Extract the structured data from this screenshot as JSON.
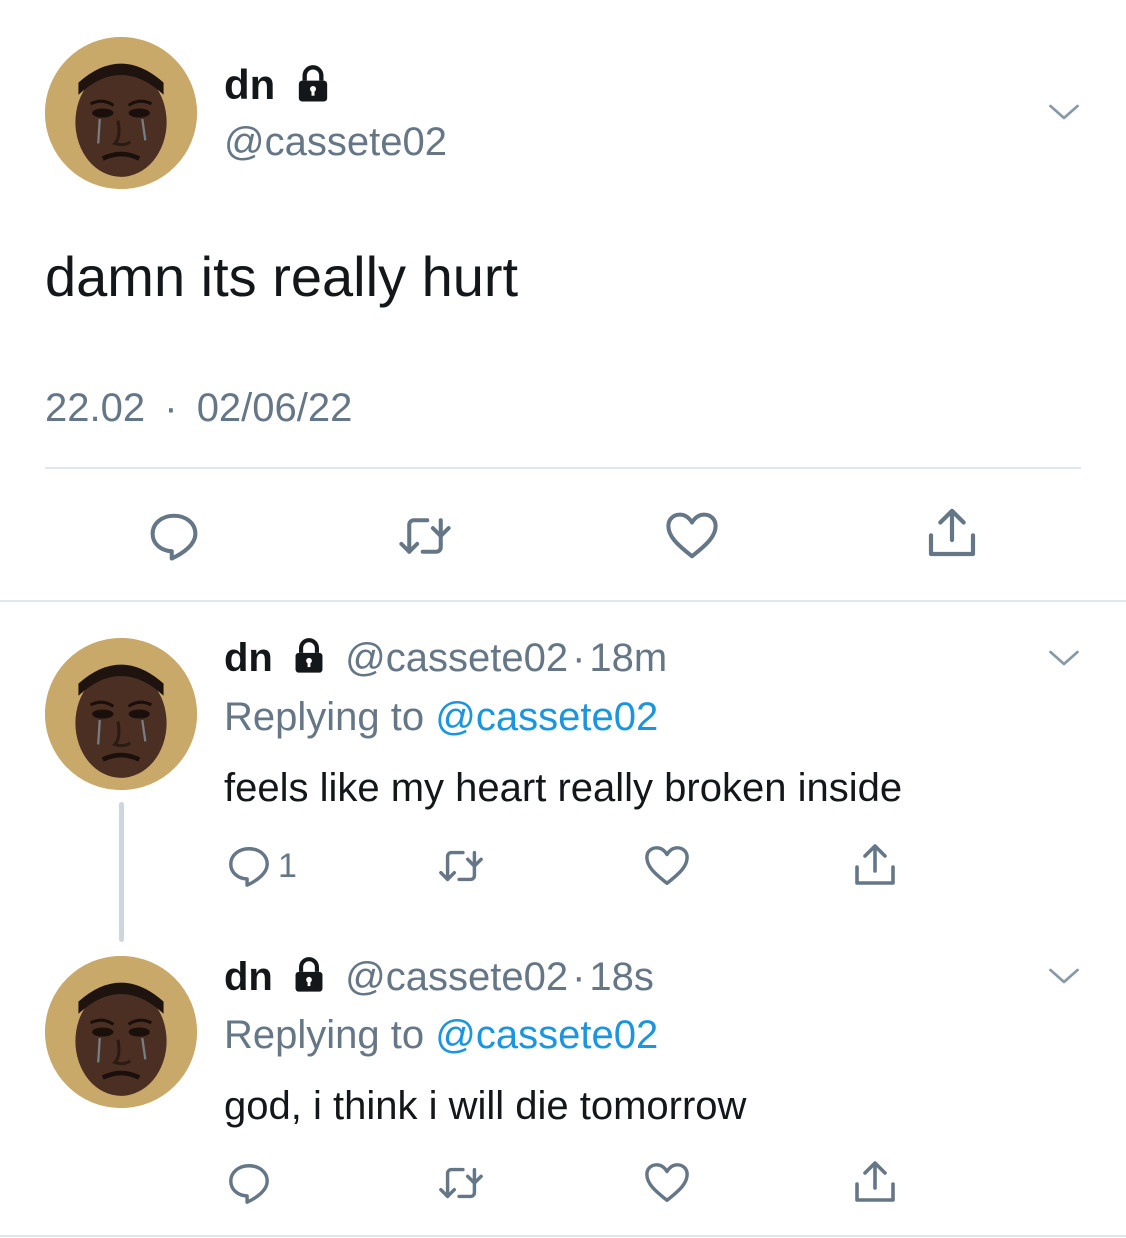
{
  "main_tweet": {
    "display_name": "dn",
    "handle": "@cassete02",
    "text": "damn its really hurt",
    "time": "22.02",
    "date": "02/06/22"
  },
  "replies": [
    {
      "display_name": "dn",
      "handle": "@cassete02",
      "age": "18m",
      "replying_prefix": "Replying to",
      "replying_handle": "@cassete02",
      "text": "feels like my heart really broken inside",
      "reply_count": "1"
    },
    {
      "display_name": "dn",
      "handle": "@cassete02",
      "age": "18s",
      "replying_prefix": "Replying to",
      "replying_handle": "@cassete02",
      "text": "god, i think i will die tomorrow",
      "reply_count": ""
    }
  ],
  "separator": "·",
  "icons": {
    "lock": "lock-icon",
    "chevron": "chevron-down-icon",
    "reply": "reply-icon",
    "retweet": "retweet-icon",
    "like": "heart-icon",
    "share": "share-icon"
  },
  "colors": {
    "text": "#14171a",
    "muted": "#657786",
    "link": "#1b95e0",
    "divider": "#e1e8ed",
    "thread_line": "#ccd6dd"
  }
}
